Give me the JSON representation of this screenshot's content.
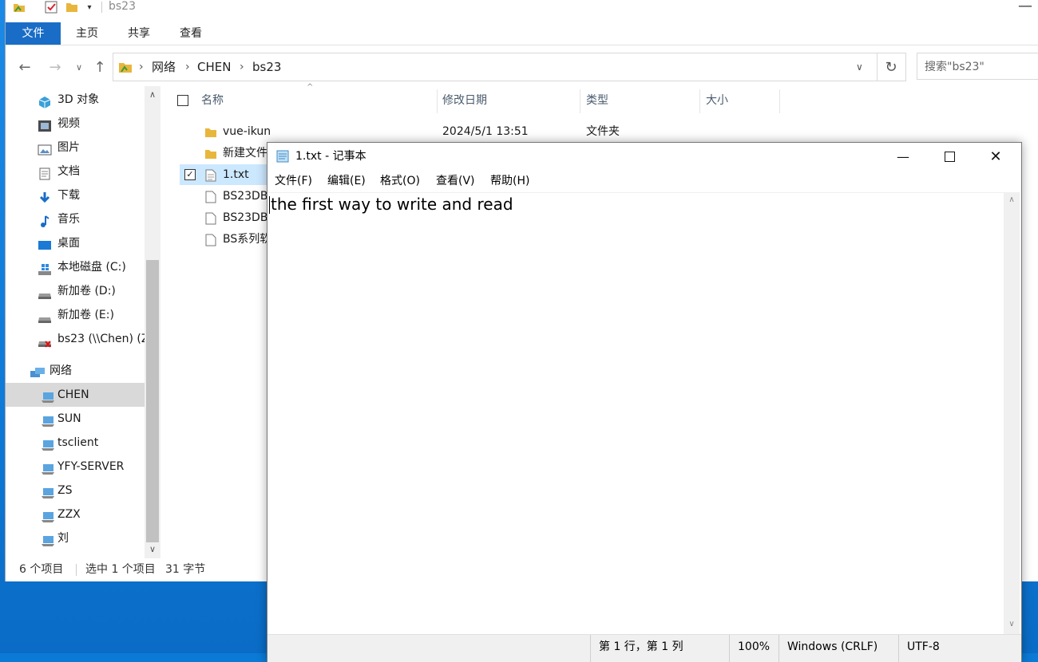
{
  "explorer": {
    "title": "bs23",
    "ribbon_tabs": [
      "文件",
      "主页",
      "共享",
      "查看"
    ],
    "path": [
      "网络",
      "CHEN",
      "bs23"
    ],
    "search_placeholder": "搜索\"bs23\"",
    "nav_items": [
      {
        "label": "3D 对象",
        "icon": "3d-objects-icon"
      },
      {
        "label": "视频",
        "icon": "videos-icon"
      },
      {
        "label": "图片",
        "icon": "pictures-icon"
      },
      {
        "label": "文档",
        "icon": "documents-icon"
      },
      {
        "label": "下载",
        "icon": "downloads-icon"
      },
      {
        "label": "音乐",
        "icon": "music-icon"
      },
      {
        "label": "桌面",
        "icon": "desktop-icon"
      },
      {
        "label": "本地磁盘 (C:)",
        "icon": "drive-icon"
      },
      {
        "label": "新加卷 (D:)",
        "icon": "drive-icon"
      },
      {
        "label": "新加卷 (E:)",
        "icon": "drive-icon"
      },
      {
        "label": "bs23 (\\\\Chen) (Z",
        "icon": "network-drive-disconnected-icon"
      },
      {
        "label": "网络",
        "icon": "network-icon"
      },
      {
        "label": "CHEN",
        "icon": "computer-icon"
      },
      {
        "label": "SUN",
        "icon": "computer-icon"
      },
      {
        "label": "tsclient",
        "icon": "computer-icon"
      },
      {
        "label": "YFY-SERVER",
        "icon": "computer-icon"
      },
      {
        "label": "ZS",
        "icon": "computer-icon"
      },
      {
        "label": "ZZX",
        "icon": "computer-icon"
      },
      {
        "label": "刘",
        "icon": "computer-icon"
      }
    ],
    "columns": [
      "名称",
      "修改日期",
      "类型",
      "大小"
    ],
    "files": [
      {
        "name": "vue-ikun",
        "date": "2024/5/1 13:51",
        "type": "文件夹",
        "icon": "folder-icon"
      },
      {
        "name": "新建文件",
        "date": "",
        "type": "",
        "icon": "folder-icon"
      },
      {
        "name": "1.txt",
        "date": "",
        "type": "",
        "icon": "text-file-icon"
      },
      {
        "name": "BS23DB.",
        "date": "",
        "type": "",
        "icon": "file-icon"
      },
      {
        "name": "BS23DB_",
        "date": "",
        "type": "",
        "icon": "file-icon"
      },
      {
        "name": "BS系列软",
        "date": "",
        "type": "",
        "icon": "file-icon"
      }
    ],
    "status": {
      "count": "6 个项目",
      "selection": "选中 1 个项目",
      "size": "31 字节"
    }
  },
  "notepad": {
    "title": "1.txt - 记事本",
    "menu": [
      "文件(F)",
      "编辑(E)",
      "格式(O)",
      "查看(V)",
      "帮助(H)"
    ],
    "content": "the first way to write and read",
    "status": {
      "position": "第 1 行，第 1 列",
      "zoom": "100%",
      "line_ending": "Windows (CRLF)",
      "encoding": "UTF-8"
    }
  },
  "colors": {
    "accent": "#1a6dc6",
    "selection": "#cce8ff",
    "folder": "#e8b63c"
  }
}
